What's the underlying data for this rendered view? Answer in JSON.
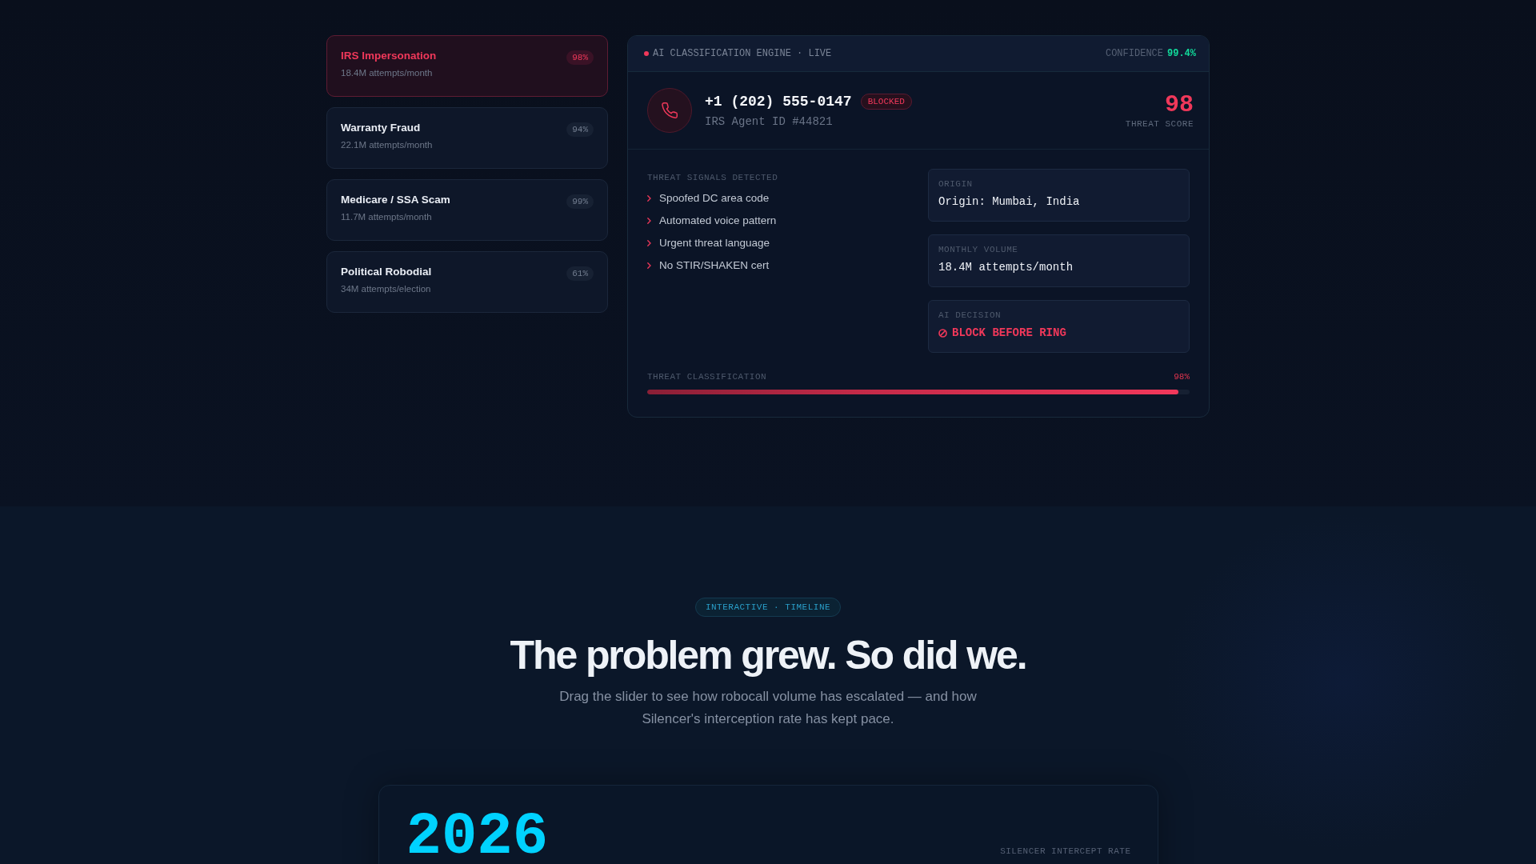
{
  "threat_types": [
    {
      "title": "IRS Impersonation",
      "subtitle": "18.4M attempts/month",
      "score": "98%",
      "selected": true
    },
    {
      "title": "Warranty Fraud",
      "subtitle": "22.1M attempts/month",
      "score": "94%",
      "selected": false
    },
    {
      "title": "Medicare / SSA Scam",
      "subtitle": "11.7M attempts/month",
      "score": "99%",
      "selected": false
    },
    {
      "title": "Political Robodial",
      "subtitle": "34M attempts/election",
      "score": "61%",
      "selected": false
    }
  ],
  "engine": {
    "title": "AI CLASSIFICATION ENGINE · LIVE",
    "confidence_label": "CONFIDENCE",
    "confidence_value": "99.4%"
  },
  "caller": {
    "number": "+1 (202) 555-0147",
    "status": "BLOCKED",
    "caller_id": "IRS Agent ID #44821",
    "score": "98",
    "score_label": "THREAT SCORE"
  },
  "signals": {
    "title": "THREAT SIGNALS DETECTED",
    "items": [
      "Spoofed DC area code",
      "Automated voice pattern",
      "Urgent threat language",
      "No STIR/SHAKEN cert"
    ]
  },
  "details": [
    {
      "kind": "text",
      "label": "ORIGIN",
      "value": "Origin: Mumbai, India"
    },
    {
      "kind": "text",
      "label": "MONTHLY VOLUME",
      "value": "18.4M attempts/month"
    },
    {
      "kind": "decision",
      "label": "AI DECISION",
      "value": "BLOCK BEFORE RING"
    }
  ],
  "classification": {
    "label": "THREAT CLASSIFICATION",
    "reading": "98%",
    "level": 0.98
  },
  "timeline": {
    "tag": "INTERACTIVE · TIMELINE",
    "heading": "The problem grew. So did we.",
    "description": "Drag the slider to see how robocall volume has escalated — and how Silencer's interception rate has kept pace.",
    "year": "2026",
    "rate_label": "SILENCER INTERCEPT RATE"
  }
}
